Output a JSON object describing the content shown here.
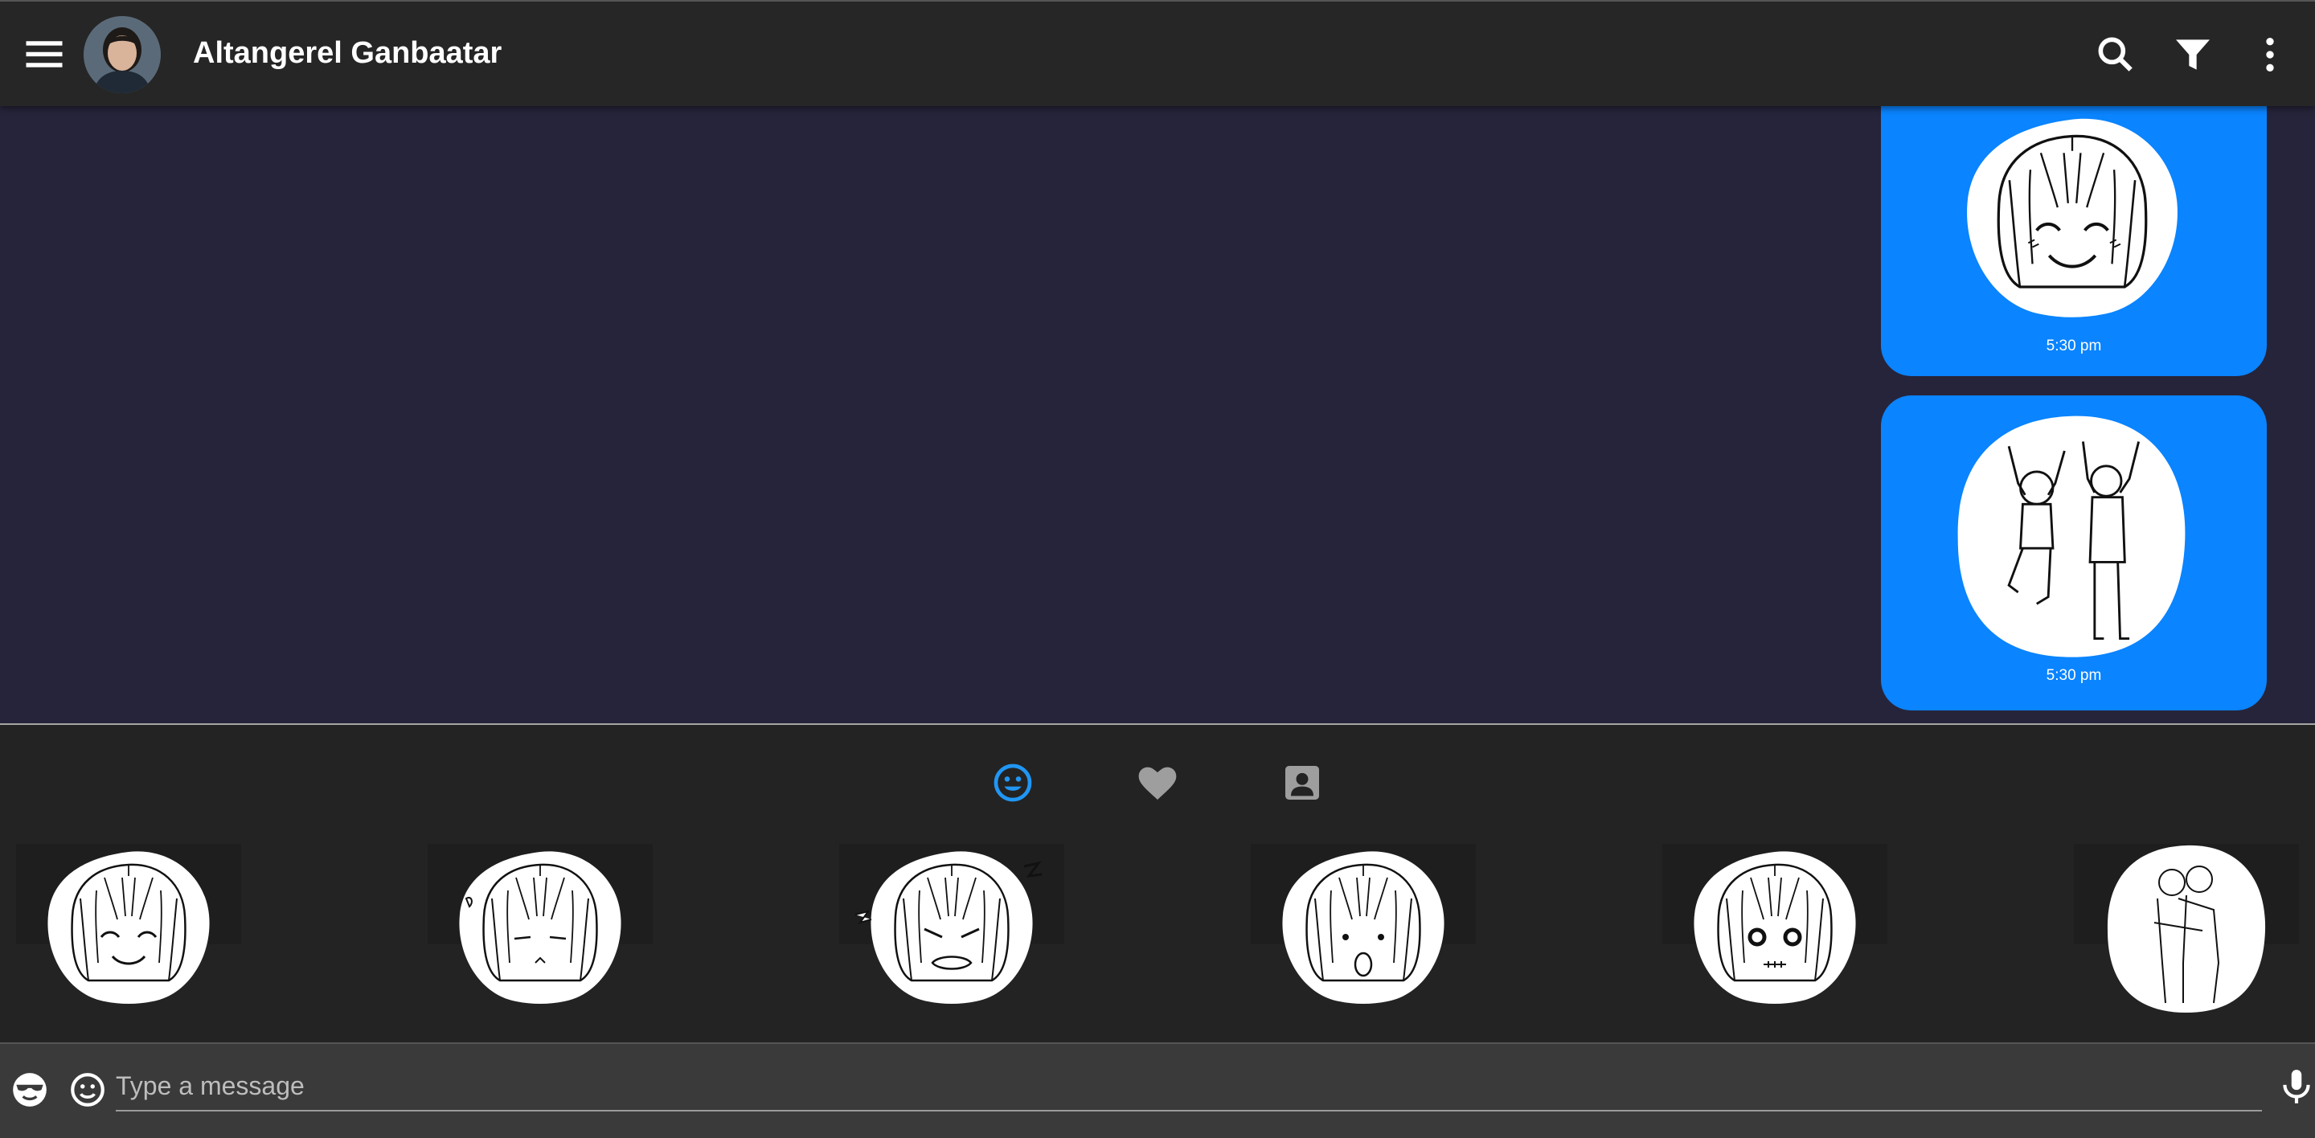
{
  "header": {
    "contact_name": "Altangerel Ganbaatar",
    "icons": {
      "menu": "menu-icon",
      "search": "search-icon",
      "filter": "filter-icon",
      "more": "more-vert-icon"
    }
  },
  "messages": [
    {
      "type": "sticker",
      "sticker": "smiling-face",
      "time": "5:30 pm",
      "direction": "outgoing"
    },
    {
      "type": "sticker",
      "sticker": "two-people-jumping",
      "time": "5:30 pm",
      "direction": "outgoing"
    }
  ],
  "sticker_panel": {
    "tabs": [
      {
        "icon": "emoji-icon",
        "active": true
      },
      {
        "icon": "heart-icon",
        "active": false
      },
      {
        "icon": "contact-icon",
        "active": false
      }
    ],
    "stickers": [
      "smiling-face",
      "sad-face",
      "angry-face",
      "surprised-face",
      "shocked-face",
      "two-people-hugging"
    ]
  },
  "composer": {
    "placeholder": "Type a message",
    "value": ""
  },
  "colors": {
    "appbar": "#262626",
    "chat_background": "#26243a",
    "bubble": "#0a84ff",
    "active_tab": "#2196f3",
    "inactive_tab": "#9e9e9e"
  }
}
